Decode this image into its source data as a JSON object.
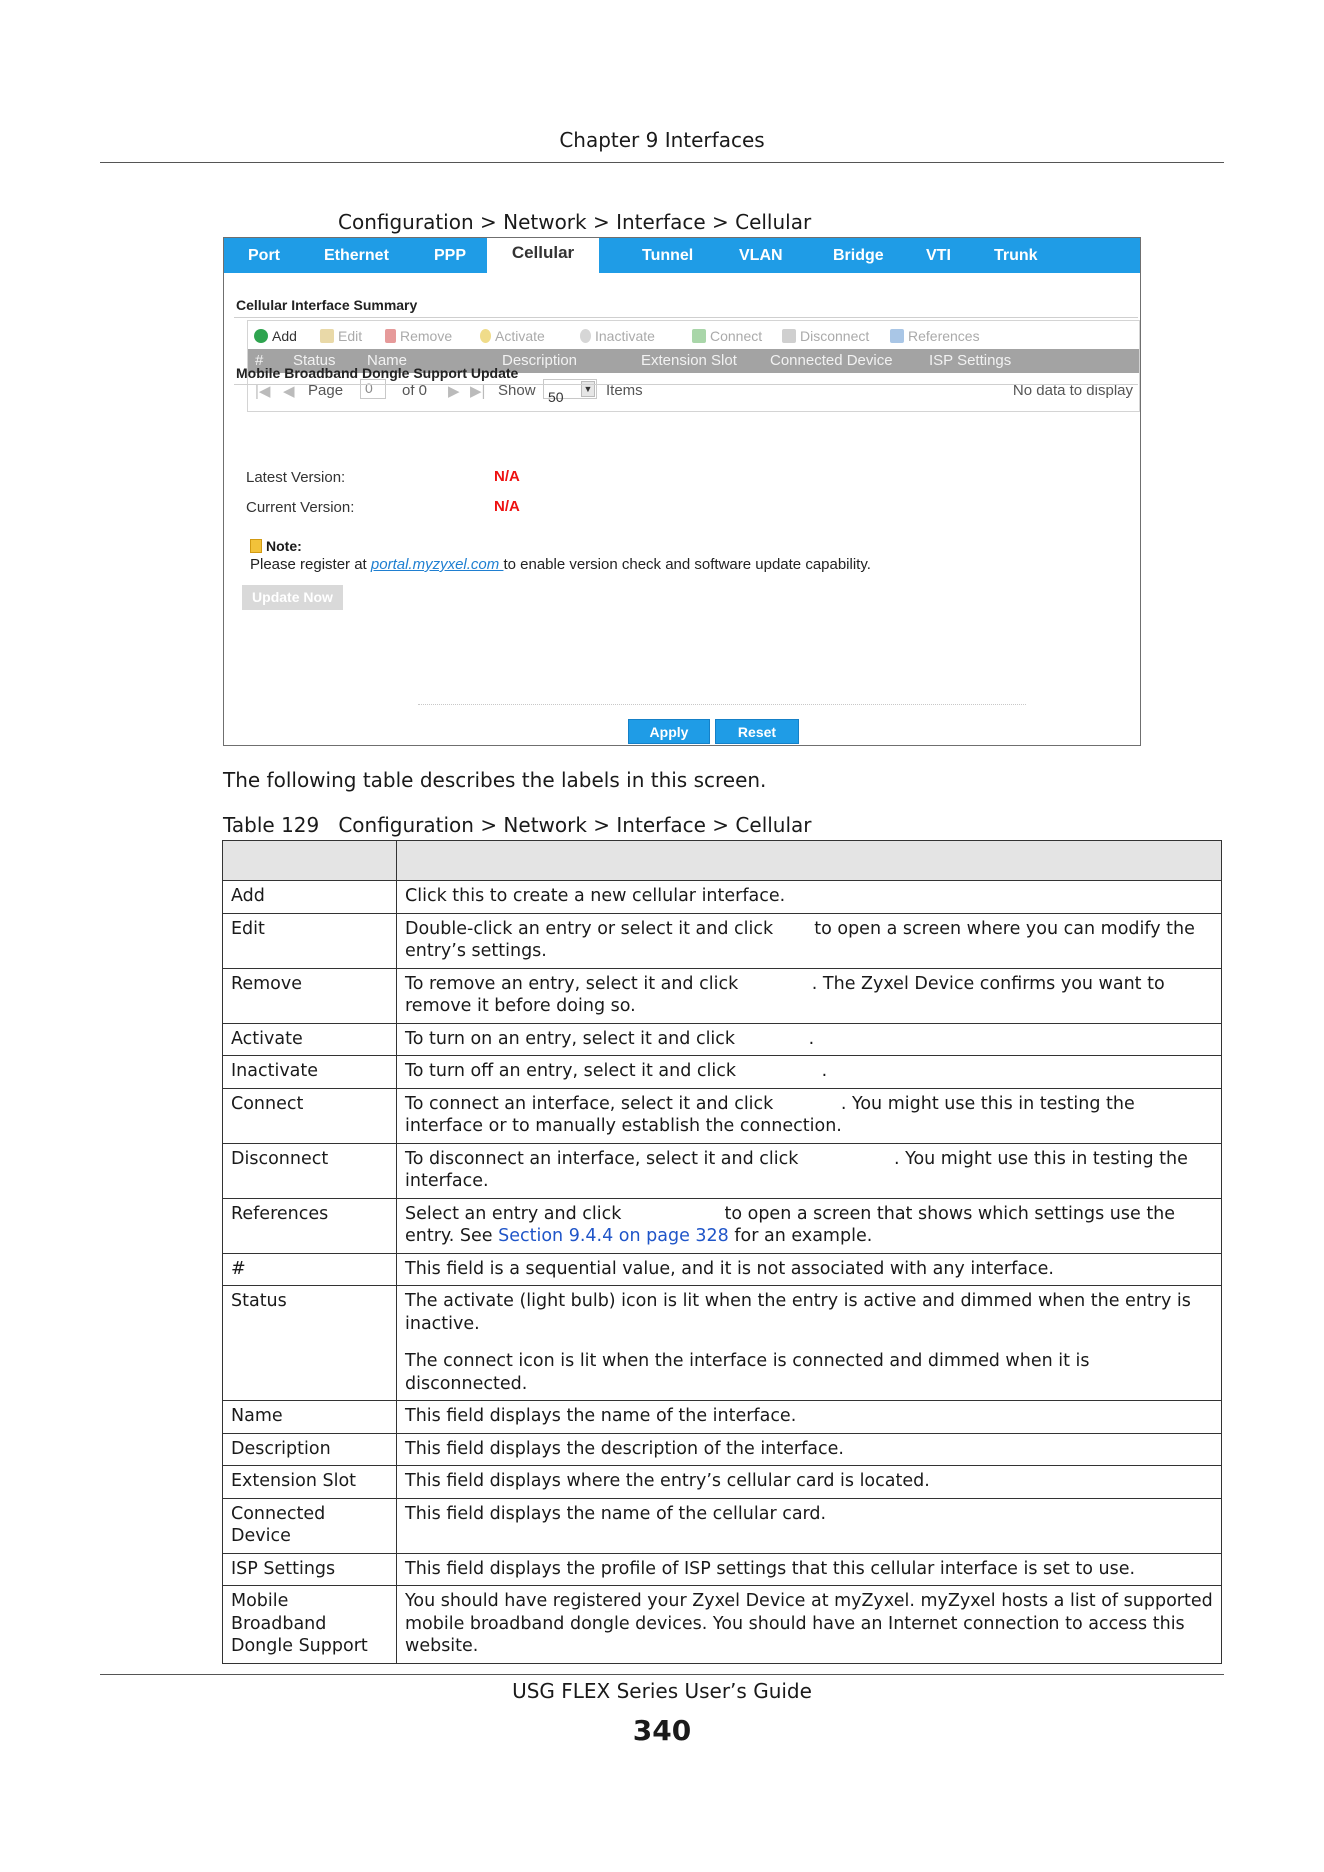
{
  "chapter_header": "Chapter 9 Interfaces",
  "figure_caption": "Configuration > Network > Interface > Cellular",
  "tabs": [
    "Port",
    "Ethernet",
    "PPP",
    "Cellular",
    "Tunnel",
    "VLAN",
    "Bridge",
    "VTI",
    "Trunk"
  ],
  "summary": {
    "title": "Cellular Interface Summary",
    "toolbar": [
      "Add",
      "Edit",
      "Remove",
      "Activate",
      "Inactivate",
      "Connect",
      "Disconnect",
      "References"
    ],
    "columns": [
      "#",
      "Status",
      "Name",
      "Description",
      "Extension Slot",
      "Connected Device",
      "ISP Settings"
    ],
    "pager": {
      "page_label": "Page",
      "page_value": "0",
      "of_label": "of 0",
      "show_label": "Show",
      "show_value": "50",
      "items_label": "Items",
      "empty_text": "No data to display"
    }
  },
  "dongle": {
    "title": "Mobile Broadband Dongle Support Update",
    "latest_label": "Latest Version:",
    "latest_value": "N/A",
    "current_label": "Current Version:",
    "current_value": "N/A",
    "note_title": "Note:",
    "note_before": "Please register at ",
    "note_link": "portal.myzyxel.com ",
    "note_after": "to enable version check and software update capability.",
    "update_button": "Update Now"
  },
  "buttons": {
    "apply": "Apply",
    "reset": "Reset"
  },
  "intro_text": "The following table describes the labels in this screen.",
  "table_caption": "Table 129   Configuration > Network > Interface > Cellular",
  "table_rows": {
    "add": {
      "label": "Add",
      "text": "Click this to create a new cellular interface."
    },
    "edit": {
      "label": "Edit",
      "before": "Double-click an entry or select it and click ",
      "after": " to open a screen where you can modify the entry’s settings."
    },
    "remove": {
      "label": "Remove",
      "before": "To remove an entry, select it and click ",
      "after": ". The Zyxel Device confirms you want to remove it before doing so."
    },
    "activate": {
      "label": "Activate",
      "before": "To turn on an entry, select it and click ",
      "after": "."
    },
    "inactivate": {
      "label": "Inactivate",
      "before": "To turn off an entry, select it and click ",
      "after": "."
    },
    "connect": {
      "label": "Connect",
      "before": "To connect an interface, select it and click ",
      "after": ". You might use this in testing the interface or to manually establish the connection."
    },
    "disconnect": {
      "label": "Disconnect",
      "before": "To disconnect an interface, select it and click ",
      "after": ". You might use this in testing the interface."
    },
    "references": {
      "label": "References",
      "before": "Select an entry and click ",
      "mid": " to open a screen that shows which settings use the entry. See ",
      "link": "Section 9.4.4 on page 328",
      "after": " for an example."
    },
    "number": {
      "label": "#",
      "text": "This field is a sequential value, and it is not associated with any interface."
    },
    "status": {
      "label": "Status",
      "p1": "The activate (light bulb) icon is lit when the entry is active and dimmed when the entry is inactive.",
      "p2": "The connect icon is lit when the interface is connected and dimmed when it is disconnected."
    },
    "name": {
      "label": "Name",
      "text": "This field displays the name of the interface."
    },
    "description": {
      "label": "Description",
      "text": "This field displays the description of the interface."
    },
    "extension_slot": {
      "label": "Extension Slot",
      "text": "This field displays where the entry’s cellular card is located."
    },
    "connected_device": {
      "label": "Connected Device",
      "text": "This field displays the name of the cellular card."
    },
    "isp_settings": {
      "label": "ISP Settings",
      "text": "This field displays the profile of ISP settings that this cellular interface is set to use."
    },
    "dongle_support": {
      "label": "Mobile Broadband Dongle Support",
      "text": "You should have registered your Zyxel Device at myZyxel. myZyxel hosts a list of supported mobile broadband dongle devices. You should have an Internet connection to access this website."
    }
  },
  "footer": "USG FLEX Series User’s Guide",
  "page_number": "340",
  "colors": {
    "tab_blue": "#1f9ce6",
    "na_red": "#e11111",
    "link_blue": "#1f55c8"
  }
}
